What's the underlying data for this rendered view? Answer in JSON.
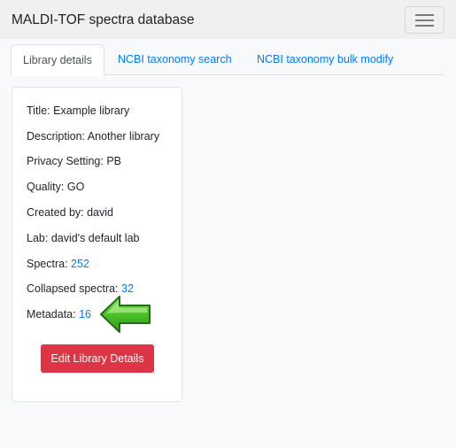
{
  "navbar": {
    "brand": "MALDI-TOF spectra database",
    "toggler_icon": "hamburger-menu-icon"
  },
  "tabs": [
    {
      "label": "Library details",
      "active": true
    },
    {
      "label": "NCBI taxonomy search",
      "active": false
    },
    {
      "label": "NCBI taxonomy bulk modify",
      "active": false
    }
  ],
  "library": {
    "title_label": "Title: ",
    "title_value": "Example library",
    "description_label": "Description: ",
    "description_value": "Another library",
    "privacy_label": "Privacy Setting: ",
    "privacy_value": "PB",
    "quality_label": "Quality: ",
    "quality_value": "GO",
    "created_label": "Created by: ",
    "created_value": "david",
    "lab_label": "Lab: ",
    "lab_value": "david's default lab",
    "spectra_label": "Spectra: ",
    "spectra_value": "252",
    "collapsed_label": "Collapsed spectra: ",
    "collapsed_value": "32",
    "metadata_label": "Metadata: ",
    "metadata_value": "16",
    "edit_button": "Edit Library Details"
  },
  "annotation": {
    "arrow_icon": "green-left-arrow-icon",
    "arrow_color": "#3cb521"
  },
  "colors": {
    "link": "#007bff",
    "danger": "#dc3545",
    "navbar_bg": "#f0f0f0"
  }
}
